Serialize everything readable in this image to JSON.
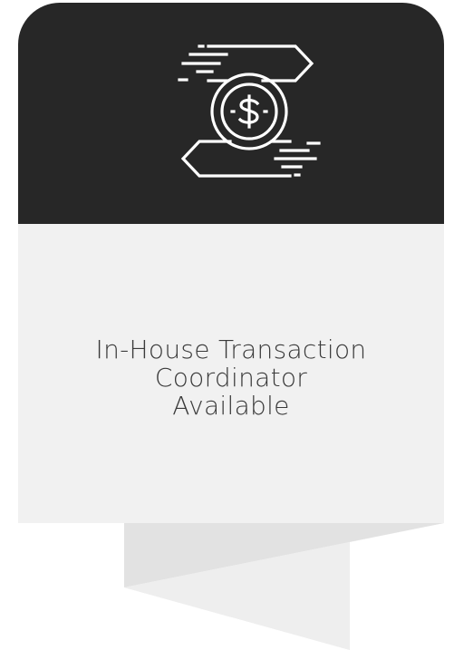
{
  "card": {
    "icon": "money-transfer-icon",
    "text": "In-House Transaction Coordinator Available"
  },
  "colors": {
    "header_background": "#272727",
    "body_background": "#f1f1f1",
    "text": "#3a3a3a",
    "icon_stroke": "#ffffff",
    "ribbon_light": "#ebebeb",
    "ribbon_shadow": "#d9d9d9"
  }
}
